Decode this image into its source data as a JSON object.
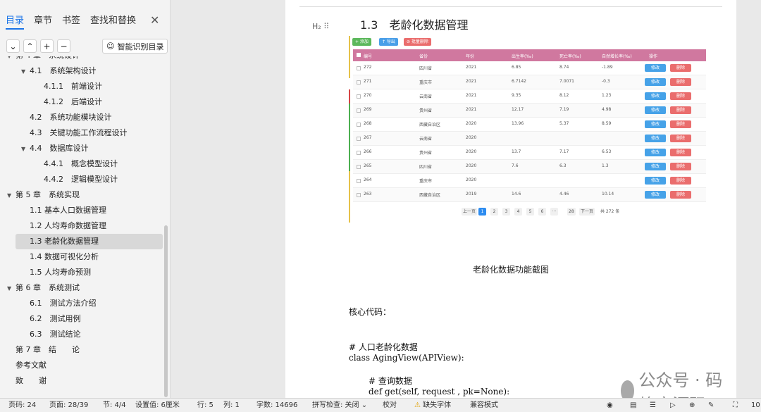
{
  "sidebar": {
    "tabs": [
      "目录",
      "章节",
      "书签",
      "查找和替换"
    ],
    "ai_button": "智能识别目录",
    "toc": [
      {
        "label": "第 4 章　系统设计",
        "level": 0,
        "expanded": true
      },
      {
        "label": "4.1　系统架构设计",
        "level": 1,
        "expanded": true
      },
      {
        "label": "4.1.1　前端设计",
        "level": 2
      },
      {
        "label": "4.1.2　后端设计",
        "level": 2
      },
      {
        "label": "4.2　系统功能模块设计",
        "level": 1
      },
      {
        "label": "4.3　关键功能工作流程设计",
        "level": 1
      },
      {
        "label": "4.4　数据库设计",
        "level": 1,
        "expanded": true
      },
      {
        "label": "4.4.1　概念模型设计",
        "level": 2
      },
      {
        "label": "4.4.2　逻辑模型设计",
        "level": 2
      },
      {
        "label": "第 5 章　系统实现",
        "level": 0,
        "expanded": true
      },
      {
        "label": "1.1  基本人口数据管理",
        "level": 1
      },
      {
        "label": "1.2  人均寿命数据管理",
        "level": 1
      },
      {
        "label": "1.3  老龄化数据管理",
        "level": 1,
        "active": true
      },
      {
        "label": "1.4  数据可视化分析",
        "level": 1
      },
      {
        "label": "1.5  人均寿命预测",
        "level": 1
      },
      {
        "label": "第 6 章　系统测试",
        "level": 0,
        "expanded": true
      },
      {
        "label": "6.1　测试方法介绍",
        "level": 1
      },
      {
        "label": "6.2　测试用例",
        "level": 1
      },
      {
        "label": "6.3　测试结论",
        "level": 1
      },
      {
        "label": "第 7 章　结　　论",
        "level": 0
      },
      {
        "label": "参考文献",
        "level": 0
      },
      {
        "label": "致　　谢",
        "level": 0
      }
    ]
  },
  "document": {
    "heading_marker": "H₂",
    "heading": "1.3　老龄化数据管理",
    "screenshot": {
      "buttons": [
        "+ 添加",
        "↑ 导出",
        "⊘ 批量删除"
      ],
      "headers": [
        "编号",
        "省份",
        "年份",
        "出生率(‰)",
        "死亡率(‰)",
        "自然增长率(‰)",
        "操作"
      ],
      "rows": [
        [
          "272",
          "四川省",
          "2021",
          "6.85",
          "8.74",
          "-1.89"
        ],
        [
          "271",
          "重庆市",
          "2021",
          "6.7142",
          "7.0071",
          "-0.3"
        ],
        [
          "270",
          "云南省",
          "2021",
          "9.35",
          "8.12",
          "1.23"
        ],
        [
          "269",
          "贵州省",
          "2021",
          "12.17",
          "7.19",
          "4.98"
        ],
        [
          "268",
          "西藏自治区",
          "2020",
          "13.96",
          "5.37",
          "8.59"
        ],
        [
          "267",
          "云南省",
          "2020",
          "",
          "",
          ""
        ],
        [
          "266",
          "贵州省",
          "2020",
          "13.7",
          "7.17",
          "6.53"
        ],
        [
          "265",
          "四川省",
          "2020",
          "7.6",
          "6.3",
          "1.3"
        ],
        [
          "264",
          "重庆市",
          "2020",
          "",
          "",
          ""
        ],
        [
          "263",
          "西藏自治区",
          "2019",
          "14.6",
          "4.46",
          "10.14"
        ]
      ],
      "edit_label": "修改",
      "delete_label": "删除",
      "pager": [
        "上一页",
        "1",
        "2",
        "3",
        "4",
        "5",
        "6",
        "···",
        "28",
        "下一页"
      ],
      "total": "共 272 条"
    },
    "caption": "老龄化数据功能截图",
    "core_code_label": "核心代码：",
    "code_comment": "# 人口老龄化数据",
    "code_class": "class AgingView(APIView):",
    "code_comment2": "# 查询数据",
    "code_def": "def get(self, request , pk=None):",
    "watermark": "公众号 · 码蜂窝源码"
  },
  "status": {
    "page_num": "页码: 24",
    "pages": "页面: 28/39",
    "section": "节: 4/4",
    "setting": "设置值: 6厘米",
    "row": "行: 5",
    "col": "列: 1",
    "words": "字数: 14696",
    "spell": "拼写检查: 关闭",
    "proof": "校对",
    "missing_font": "缺失字体",
    "compat": "兼容模式",
    "zoom": "10"
  }
}
